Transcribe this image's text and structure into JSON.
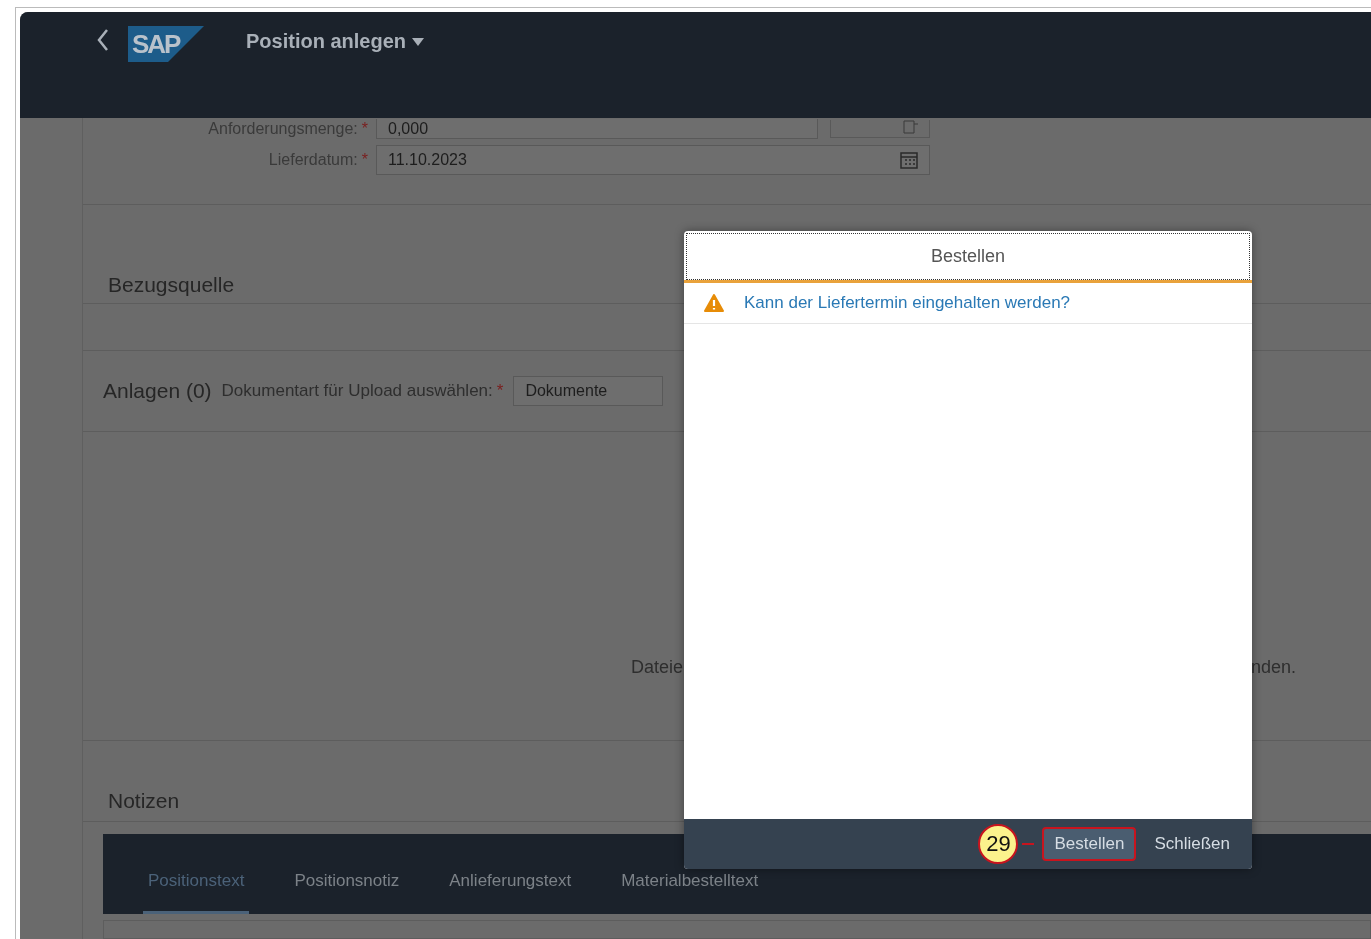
{
  "shell": {
    "logo": "SAP",
    "title": "Position anlegen"
  },
  "fields": [
    {
      "label": "Anforderungsmenge:",
      "required_mark": "*",
      "value": "0,000",
      "kind": "quantity"
    },
    {
      "label": "Lieferdatum:",
      "required_mark": "*",
      "value": "11.10.2023",
      "kind": "date"
    }
  ],
  "sections": [
    {
      "title": "Bezugsquelle"
    }
  ],
  "attachments": {
    "title": "Anlagen (0)",
    "doc_type_label": "Dokumentart für Upload auswählen:",
    "doc_type_required_mark": "*",
    "doc_type_value": "Dokumente",
    "empty_text_left": "Dateie",
    "empty_text_right": "nden."
  },
  "notes": {
    "title": "Notizen",
    "tabs": [
      {
        "label": "Positionstext",
        "selected": true
      },
      {
        "label": "Positionsnotiz",
        "selected": false
      },
      {
        "label": "Anlieferungstext",
        "selected": false
      },
      {
        "label": "Materialbestelltext",
        "selected": false
      }
    ]
  },
  "dialog": {
    "title": "Bestellen",
    "message": "Kann der Liefertermin eingehalten werden?",
    "buttons": [
      {
        "label": "Bestellen",
        "emphasized": true
      },
      {
        "label": "Schließen",
        "emphasized": false
      }
    ]
  },
  "annotation": {
    "step": "29"
  }
}
